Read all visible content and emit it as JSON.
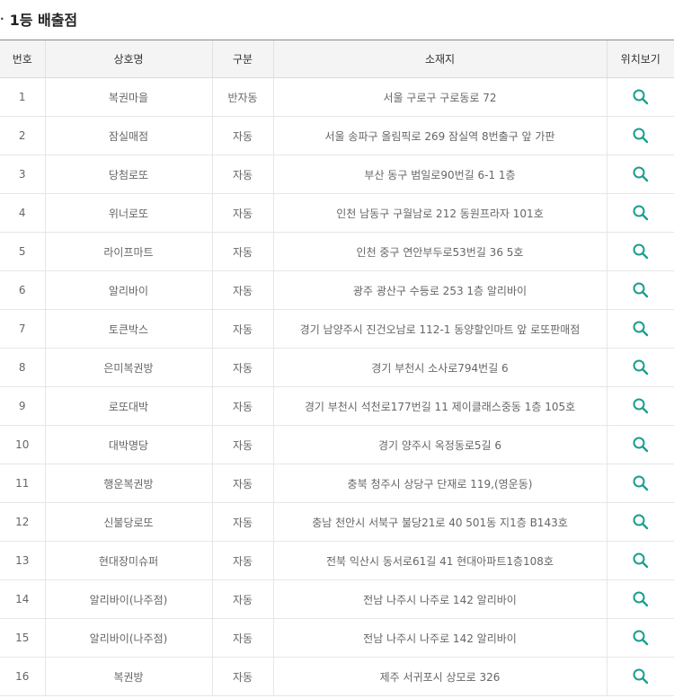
{
  "section": {
    "bullet": "·",
    "title": "1등 배출점"
  },
  "table": {
    "headers": {
      "no": "번호",
      "name": "상호명",
      "type": "구분",
      "address": "소재지",
      "map": "위치보기"
    },
    "rows": [
      {
        "no": "1",
        "name": "복권마을",
        "type": "반자동",
        "address": "서울 구로구 구로동로 72"
      },
      {
        "no": "2",
        "name": "잠실매점",
        "type": "자동",
        "address": "서울 송파구 올림픽로 269 잠실역 8번출구 앞 가판"
      },
      {
        "no": "3",
        "name": "당첨로또",
        "type": "자동",
        "address": "부산 동구 범일로90번길 6-1 1층"
      },
      {
        "no": "4",
        "name": "위너로또",
        "type": "자동",
        "address": "인천 남동구 구월남로 212 동원프라자 101호"
      },
      {
        "no": "5",
        "name": "라이프마트",
        "type": "자동",
        "address": "인천 중구 연안부두로53번길 36 5호"
      },
      {
        "no": "6",
        "name": "알리바이",
        "type": "자동",
        "address": "광주 광산구 수등로 253 1층 알리바이"
      },
      {
        "no": "7",
        "name": "토큰박스",
        "type": "자동",
        "address": "경기 남양주시 진건오남로 112-1 동양할인마트 앞 로또판매점"
      },
      {
        "no": "8",
        "name": "은미복권방",
        "type": "자동",
        "address": "경기 부천시 소사로794번길 6"
      },
      {
        "no": "9",
        "name": "로또대박",
        "type": "자동",
        "address": "경기 부천시 석천로177번길 11 제이클래스중동 1층 105호"
      },
      {
        "no": "10",
        "name": "대박명당",
        "type": "자동",
        "address": "경기 양주시 옥정동로5길 6"
      },
      {
        "no": "11",
        "name": "행운복권방",
        "type": "자동",
        "address": "충북 청주시 상당구 단재로 119,(영운동)"
      },
      {
        "no": "12",
        "name": "신불당로또",
        "type": "자동",
        "address": "충남 천안시 서북구 불당21로 40 501동 지1층 B143호"
      },
      {
        "no": "13",
        "name": "현대장미슈퍼",
        "type": "자동",
        "address": "전북 익산시 동서로61길 41 현대아파트1층108호"
      },
      {
        "no": "14",
        "name": "알리바이(나주점)",
        "type": "자동",
        "address": "전남 나주시 나주로 142 알리바이"
      },
      {
        "no": "15",
        "name": "알리바이(나주점)",
        "type": "자동",
        "address": "전남 나주시 나주로 142 알리바이"
      },
      {
        "no": "16",
        "name": "복권방",
        "type": "자동",
        "address": "제주 서귀포시 상모로 326"
      }
    ]
  },
  "icons": {
    "location": "search-icon"
  },
  "colors": {
    "icon": "#1a9e8f",
    "header_bg": "#f4f4f4",
    "top_border": "#8a8a8a"
  }
}
